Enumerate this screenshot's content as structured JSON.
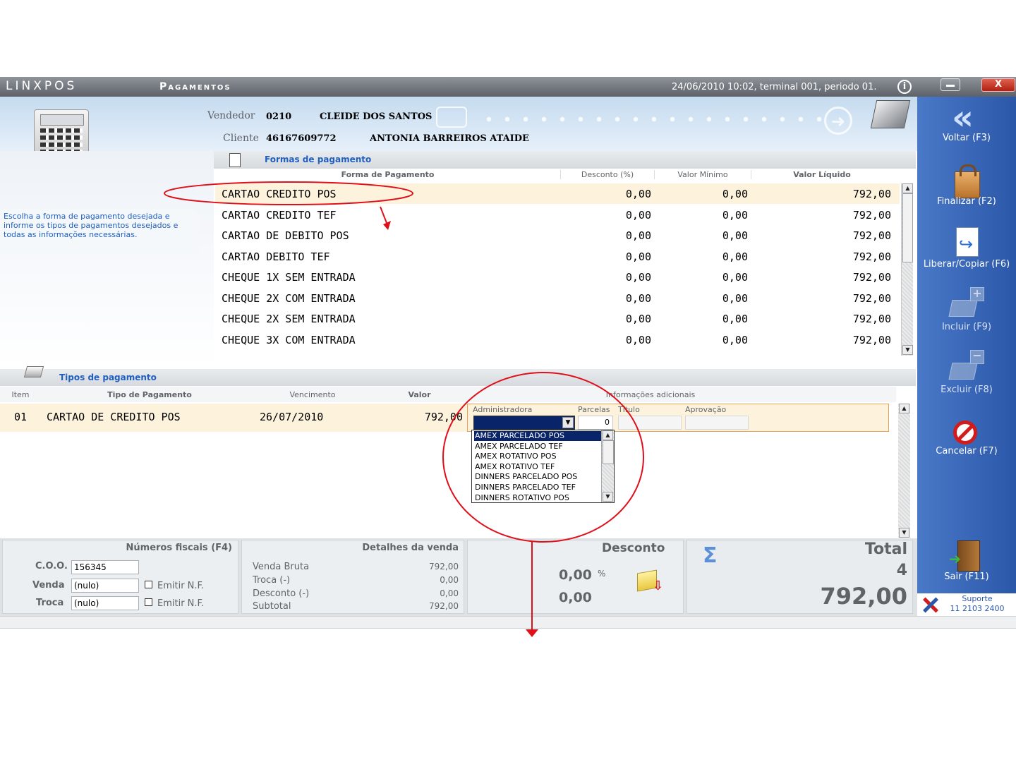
{
  "window": {
    "logo": "LINXPOS",
    "screen_title": "Pagamentos",
    "datetime_status": "24/06/2010 10:02, terminal 001, periodo 01.",
    "info_icon": "info-icon",
    "close_label": "X"
  },
  "header": {
    "vendedor_label": "Vendedor",
    "vendedor_code": "0210",
    "vendedor_name": "CLEIDE DOS SANTOS",
    "cliente_label": "Cliente",
    "cliente_code": "46167609772",
    "cliente_name": "ANTONIA BARREIROS ATAIDE"
  },
  "help_text": "Escolha a forma de pagamento desejada e informe os tipos de pagamentos desejados e todas as informações necessárias.",
  "formas": {
    "section_title": "Formas de pagamento",
    "columns": [
      "Forma de Pagamento",
      "Desconto (%)",
      "Valor Mínimo",
      "Valor Líquido"
    ],
    "rows": [
      {
        "forma": "CARTAO CREDITO POS",
        "desconto": "0,00",
        "minimo": "0,00",
        "liquido": "792,00"
      },
      {
        "forma": "CARTAO CREDITO TEF",
        "desconto": "0,00",
        "minimo": "0,00",
        "liquido": "792,00"
      },
      {
        "forma": "CARTAO DE DEBITO POS",
        "desconto": "0,00",
        "minimo": "0,00",
        "liquido": "792,00"
      },
      {
        "forma": "CARTAO DEBITO TEF",
        "desconto": "0,00",
        "minimo": "0,00",
        "liquido": "792,00"
      },
      {
        "forma": "CHEQUE 1X SEM ENTRADA",
        "desconto": "0,00",
        "minimo": "0,00",
        "liquido": "792,00"
      },
      {
        "forma": "CHEQUE 2X COM ENTRADA",
        "desconto": "0,00",
        "minimo": "0,00",
        "liquido": "792,00"
      },
      {
        "forma": "CHEQUE 2X SEM ENTRADA",
        "desconto": "0,00",
        "minimo": "0,00",
        "liquido": "792,00"
      },
      {
        "forma": "CHEQUE 3X COM ENTRADA",
        "desconto": "0,00",
        "minimo": "0,00",
        "liquido": "792,00"
      }
    ]
  },
  "tipos": {
    "section_title": "Tipos de pagamento",
    "columns": [
      "Item",
      "Tipo de Pagamento",
      "Vencimento",
      "Valor",
      "Informações adicionais"
    ],
    "row": {
      "item": "01",
      "tipo": "CARTAO DE CREDITO POS",
      "vencimento": "26/07/2010",
      "valor": "792,00"
    },
    "extra": {
      "administradora_label": "Administradora",
      "parcelas_label": "Parcelas",
      "parcelas_value": "0",
      "titulo_label": "Título",
      "aprovacao_label": "Aprovação"
    },
    "dropdown_options": [
      "AMEX PARCELADO POS",
      "AMEX PARCELADO TEF",
      "AMEX ROTATIVO POS",
      "AMEX ROTATIVO TEF",
      "DINNERS PARCELADO POS",
      "DINNERS PARCELADO TEF",
      "DINNERS ROTATIVO POS"
    ],
    "dropdown_selected_index": 0
  },
  "fiscais": {
    "title": "Números fiscais (F4)",
    "coo_label": "C.O.O.",
    "coo_value": "156345",
    "venda_label": "Venda",
    "venda_value": "(nulo)",
    "troca_label": "Troca",
    "troca_value": "(nulo)",
    "emitir_label": "Emitir N.F."
  },
  "detalhes": {
    "title": "Detalhes da venda",
    "venda_bruta_label": "Venda Bruta",
    "venda_bruta": "792,00",
    "troca_label": "Troca (-)",
    "troca": "0,00",
    "desconto_label": "Desconto (-)",
    "desconto": "0,00",
    "subtotal_label": "Subtotal",
    "subtotal": "792,00"
  },
  "desconto_box": {
    "title": "Desconto",
    "percent": "0,00",
    "percent_sign": "%",
    "value": "0,00"
  },
  "total_box": {
    "title": "Total",
    "items": "4",
    "value": "792,00",
    "sigma": "Σ"
  },
  "sidebar": {
    "items": [
      {
        "label": "Voltar (F3)",
        "icon": "back-arrow-icon"
      },
      {
        "label": "Finalizar (F2)",
        "icon": "shopping-bag-icon"
      },
      {
        "label": "Liberar/Copiar (F6)",
        "icon": "document-copy-icon"
      },
      {
        "label": "Incluir (F9)",
        "icon": "add-card-icon"
      },
      {
        "label": "Excluir (F8)",
        "icon": "remove-card-icon"
      },
      {
        "label": "Cancelar (F7)",
        "icon": "cancel-icon"
      },
      {
        "label": "Sair (F11)",
        "icon": "exit-door-icon"
      }
    ],
    "support_label": "Suporte",
    "support_phone": "11 2103 2400"
  },
  "colors": {
    "highlight_row": "#fdf3dc",
    "sidebar_blue": "#3566b8",
    "annotation_red": "#e0101a",
    "selected_option": "#0a246a"
  }
}
